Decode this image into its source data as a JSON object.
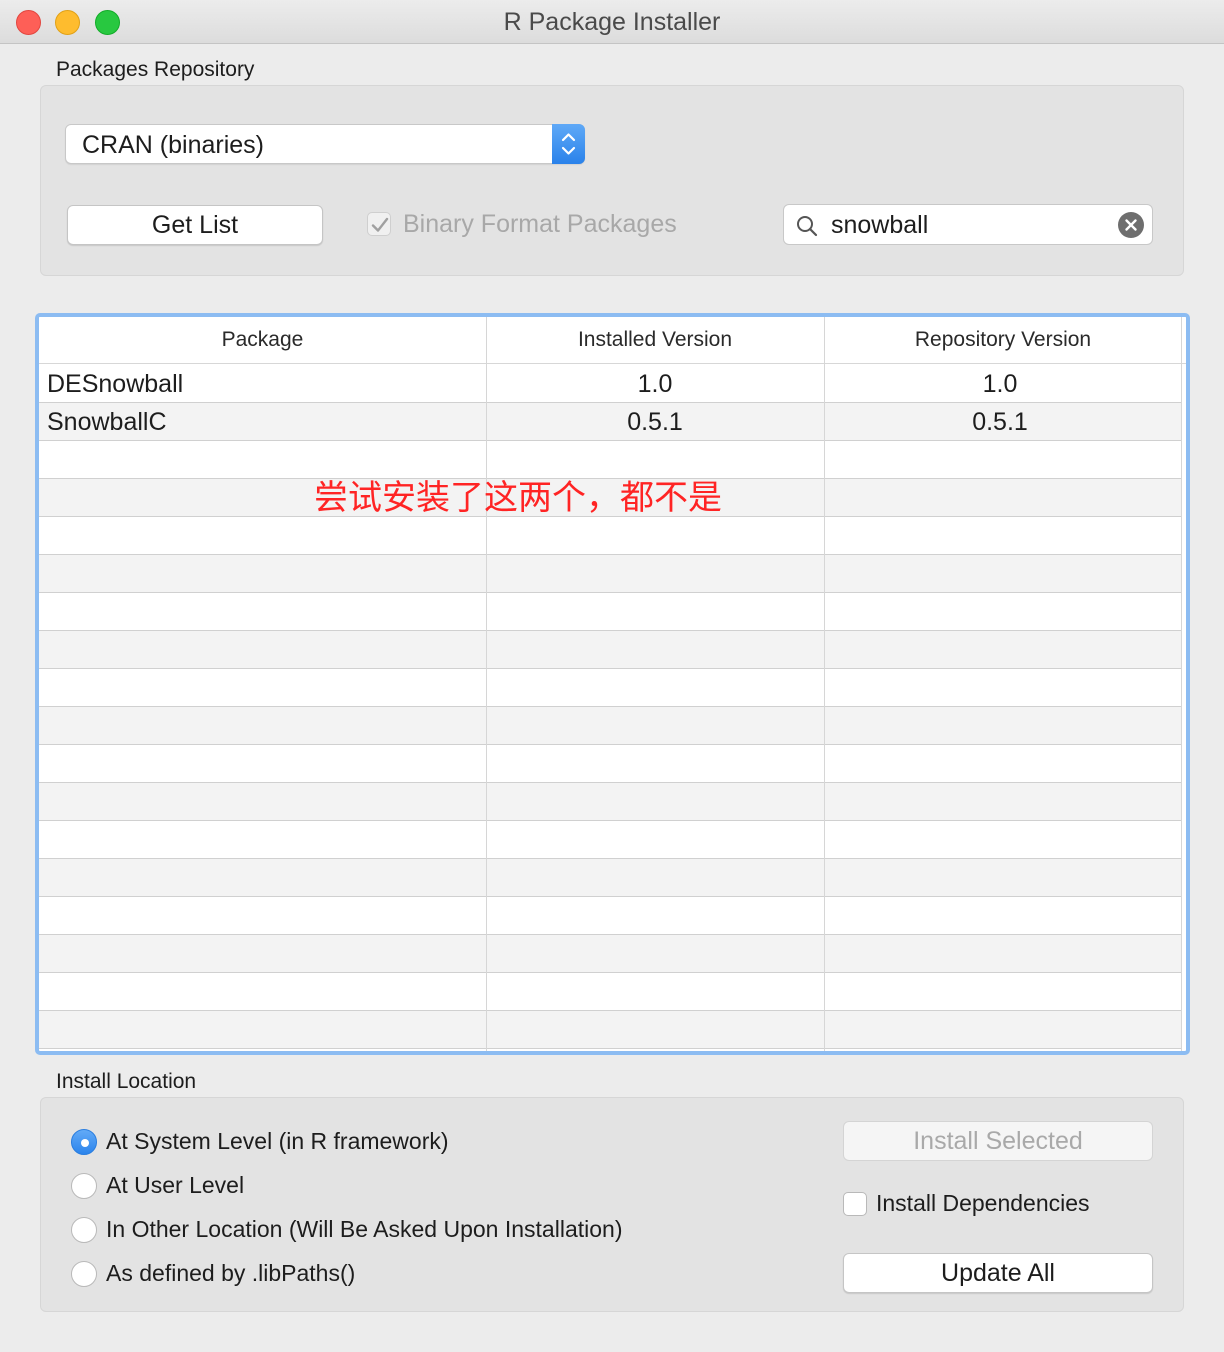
{
  "window": {
    "title": "R Package Installer"
  },
  "repository": {
    "group_label": "Packages Repository",
    "source_selected": "CRAN (binaries)",
    "get_list_label": "Get List",
    "binary_format_label": "Binary Format Packages",
    "binary_format_checked": true,
    "search_value": "snowball"
  },
  "table": {
    "columns": [
      "Package",
      "Installed Version",
      "Repository Version"
    ],
    "rows": [
      {
        "package": "DESnowball",
        "installed": "1.0",
        "repository": "1.0"
      },
      {
        "package": "SnowballC",
        "installed": "0.5.1",
        "repository": "0.5.1"
      }
    ]
  },
  "annotation": "尝试安装了这两个，都不是",
  "install": {
    "group_label": "Install Location",
    "options": [
      {
        "label": "At System Level (in R framework)",
        "selected": true
      },
      {
        "label": "At User Level",
        "selected": false
      },
      {
        "label": "In Other Location (Will Be Asked Upon Installation)",
        "selected": false
      },
      {
        "label": "As defined by .libPaths()",
        "selected": false
      }
    ],
    "install_selected_label": "Install Selected",
    "install_dependencies_label": "Install Dependencies",
    "install_dependencies_checked": false,
    "update_all_label": "Update All"
  },
  "colors": {
    "accent": "#2a82ea",
    "annotation": "#ff2424",
    "focus_ring": "#8cbcf2"
  }
}
